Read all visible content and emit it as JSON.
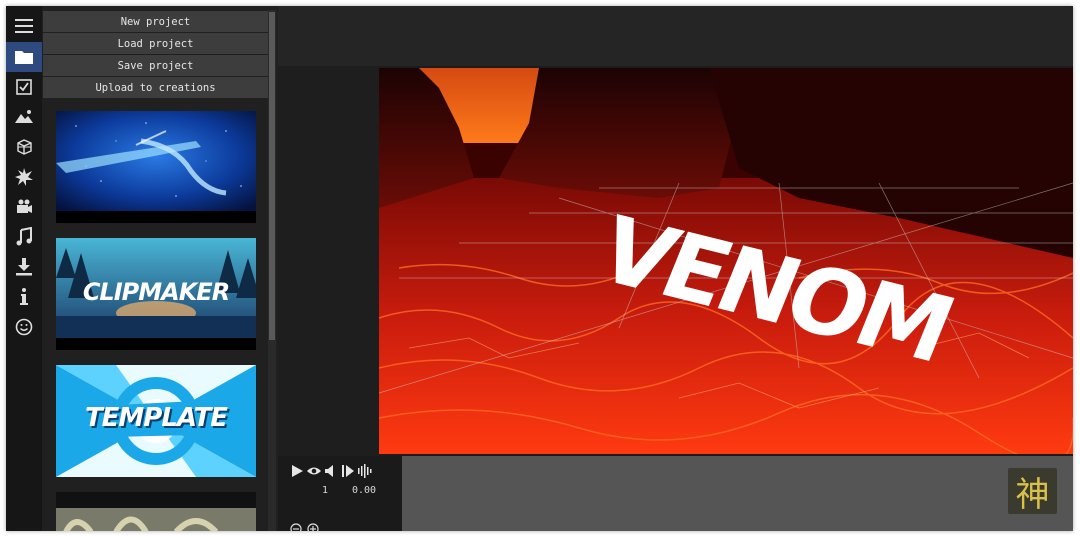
{
  "project_menu": {
    "new_project": "New project",
    "load_project": "Load project",
    "save_project": "Save project",
    "upload": "Upload to creations"
  },
  "rail": {
    "items": [
      "menu-icon",
      "folder-icon",
      "checkbox-icon",
      "image-icon",
      "cube-icon",
      "burst-icon",
      "camera-icon",
      "music-icon",
      "download-icon",
      "info-icon",
      "smiley-icon"
    ],
    "active": "folder-icon"
  },
  "templates": [
    {
      "title": ""
    },
    {
      "title": "CLIPMAKER"
    },
    {
      "title": "TEMPLATE"
    },
    {
      "title": ""
    }
  ],
  "viewport": {
    "text_3d": "VENOM"
  },
  "timeline": {
    "frame": "1",
    "time": "0.00"
  },
  "logo": {
    "glyph": "神"
  },
  "colors": {
    "accent": "#2f4a80",
    "logo_glyph": "#d9c24a"
  }
}
